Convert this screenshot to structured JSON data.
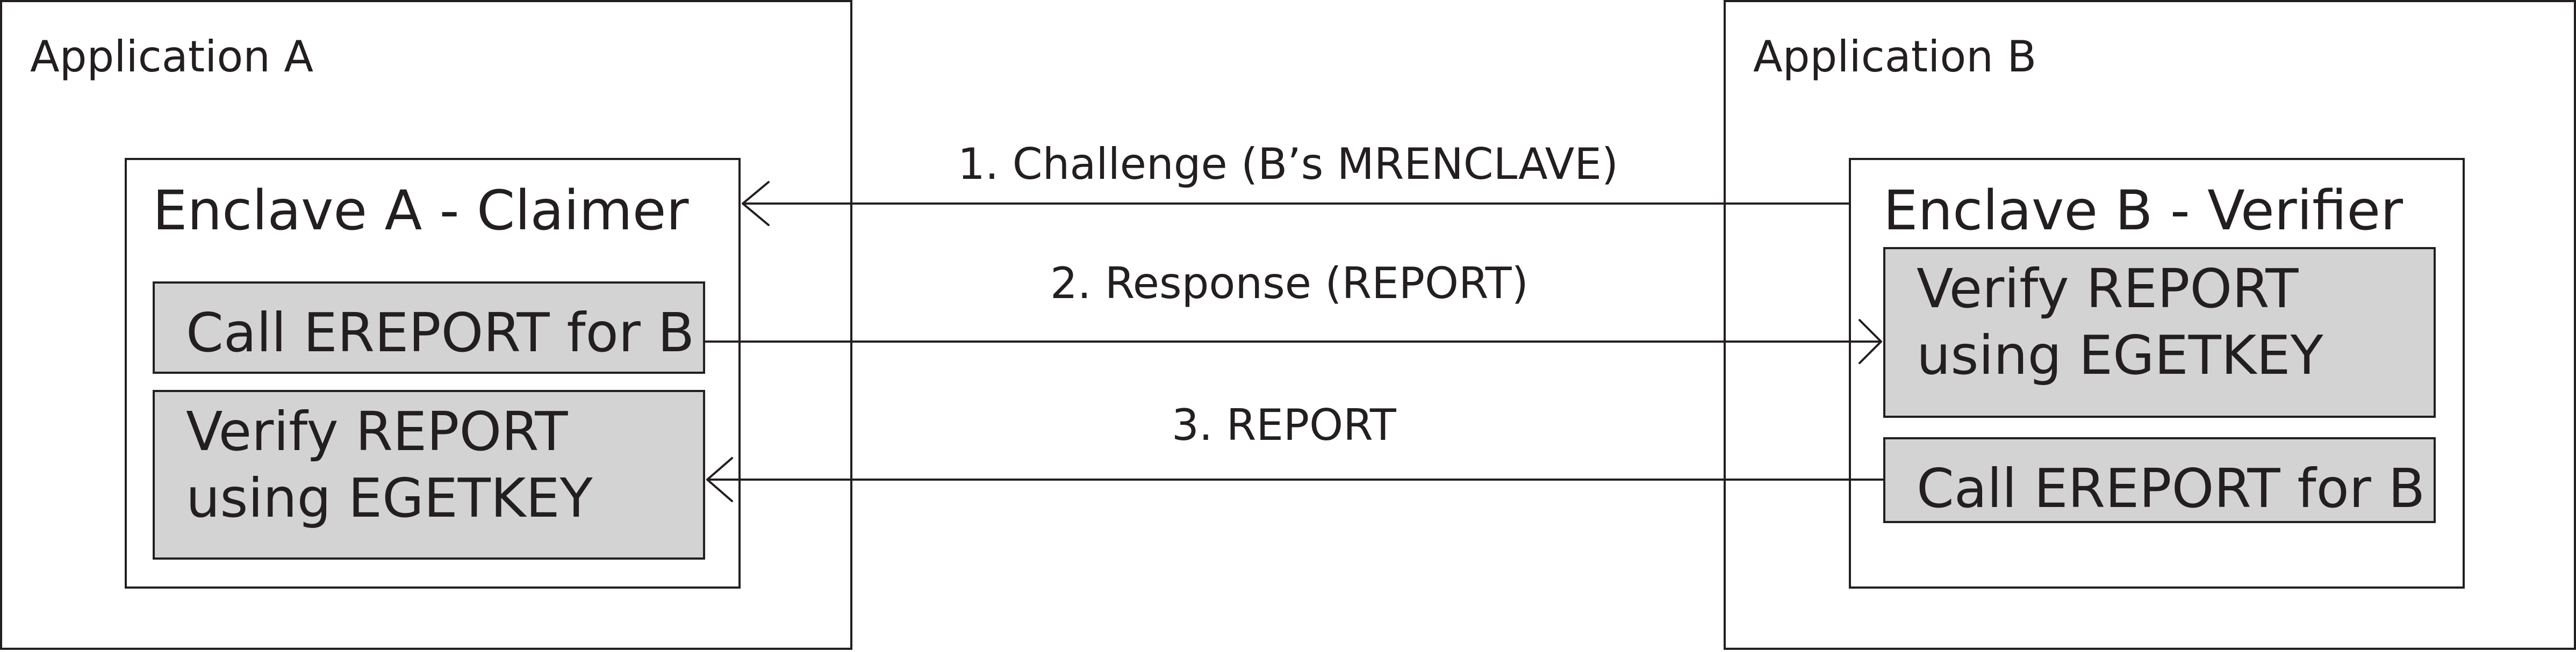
{
  "app_a": {
    "title": "Application A"
  },
  "app_b": {
    "title": "Application B"
  },
  "enclave_a": {
    "title": "Enclave A - Claimer",
    "steps": [
      {
        "lines": [
          "Call EREPORT for B"
        ]
      },
      {
        "lines": [
          "Verify REPORT",
          "using EGETKEY"
        ]
      }
    ]
  },
  "enclave_b": {
    "title": "Enclave B - Verifier",
    "steps": [
      {
        "lines": [
          "Verify REPORT",
          "using EGETKEY"
        ]
      },
      {
        "lines": [
          "Call EREPORT for B"
        ]
      }
    ]
  },
  "messages": [
    {
      "label": "1. Challenge (B’s MRENCLAVE)",
      "direction": "B-to-A"
    },
    {
      "label": "2. Response (REPORT)",
      "direction": "A-to-B"
    },
    {
      "label": "3. REPORT",
      "direction": "B-to-A"
    }
  ]
}
